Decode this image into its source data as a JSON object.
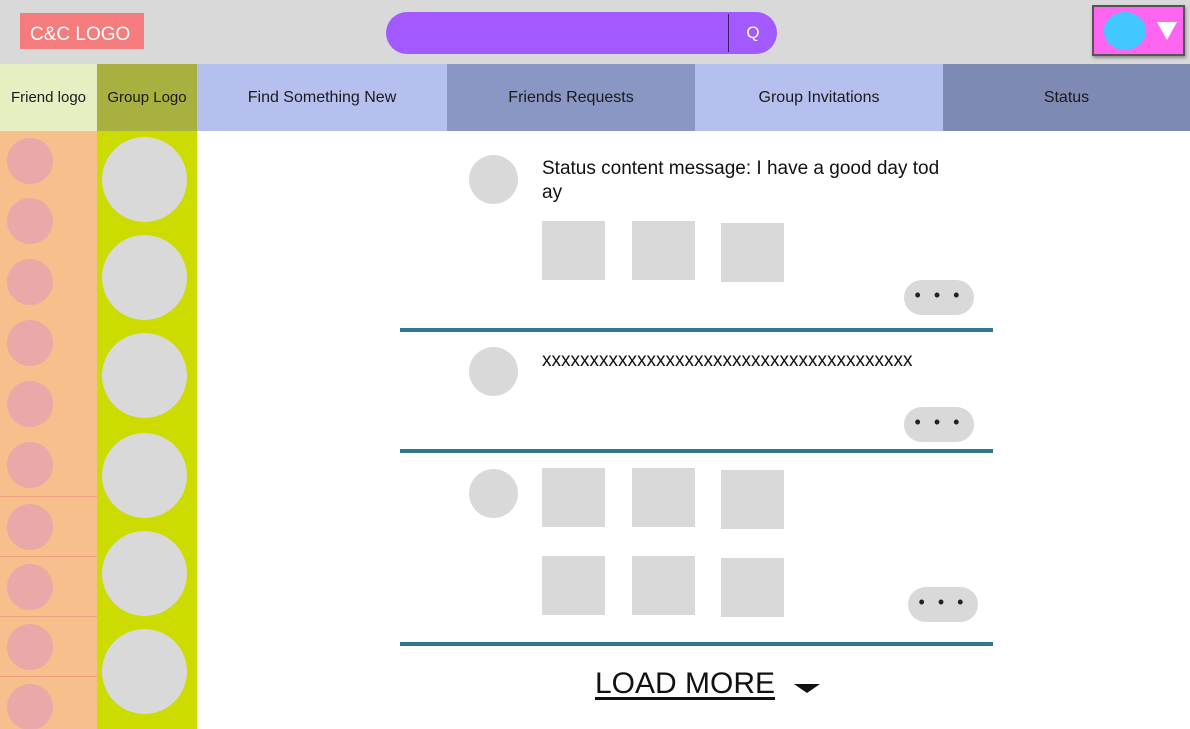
{
  "header": {
    "logo_text": "C&C LOGO",
    "search_button": "Q",
    "search_placeholder": "",
    "colors": {
      "bar": "#d9d9d9",
      "logo": "#f47c7c",
      "search": "#a259ff",
      "profile": "#ff66f0",
      "avatar": "#40c8ff"
    }
  },
  "columns": {
    "friend_header": "Friend logo",
    "group_header": "Group Logo"
  },
  "tabs": [
    {
      "label": "Find Something New"
    },
    {
      "label": "Friends Requests"
    },
    {
      "label": "Group Invitations"
    },
    {
      "label": "Status"
    }
  ],
  "feed": {
    "posts": [
      {
        "text": "Status content message: I have a good day today",
        "image_count": 3,
        "more_label": "• • •"
      },
      {
        "text": "xxxxxxxxxxxxxxxxxxxxxxxxxxxxxxxxxxxxxxx",
        "image_count": 0,
        "more_label": "• • •"
      },
      {
        "text": "",
        "image_count": 6,
        "more_label": "• • •"
      }
    ],
    "load_more_label": "LOAD MORE"
  },
  "icons": {
    "search": "search-icon",
    "profile_menu": "chevron-down-icon",
    "load_more": "caret-down-icon"
  }
}
